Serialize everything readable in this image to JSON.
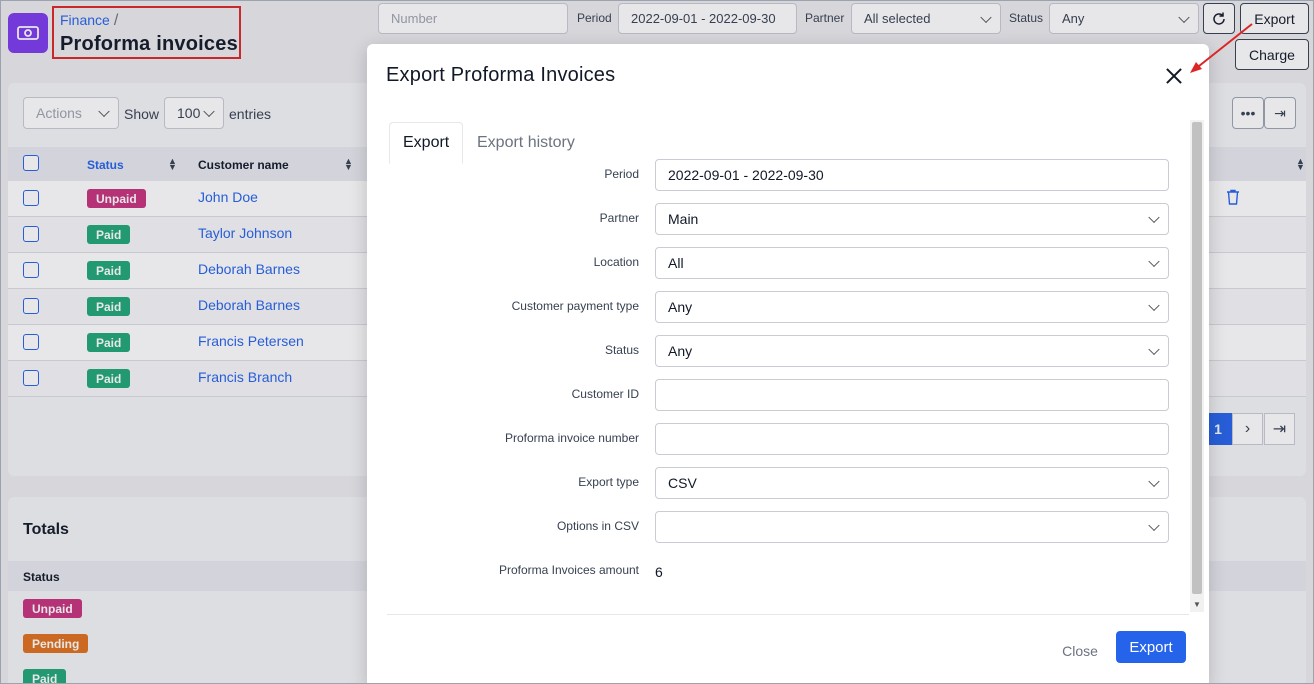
{
  "breadcrumb": {
    "parent": "Finance",
    "separator": "/"
  },
  "page": {
    "title": "Proforma invoices"
  },
  "filters": {
    "number_placeholder": "Number",
    "period_label": "Period",
    "period_value": "2022-09-01 - 2022-09-30",
    "partner_label": "Partner",
    "partner_value": "All selected",
    "status_label": "Status",
    "status_value": "Any"
  },
  "toolbar": {
    "export_label": "Export",
    "charge_label": "Charge",
    "refresh_icon": "refresh-icon"
  },
  "table": {
    "actions_label": "Actions",
    "show_label": "Show",
    "entries_value": "100",
    "entries_label": "entries",
    "columns": {
      "status": "Status",
      "customer": "Customer name"
    },
    "rows": [
      {
        "status": "Unpaid",
        "customer": "John Doe"
      },
      {
        "status": "Paid",
        "customer": "Taylor Johnson"
      },
      {
        "status": "Paid",
        "customer": "Deborah Barnes"
      },
      {
        "status": "Paid",
        "customer": "Deborah Barnes"
      },
      {
        "status": "Paid",
        "customer": "Francis Petersen"
      },
      {
        "status": "Paid",
        "customer": "Francis Branch"
      }
    ],
    "pagination": {
      "current": "1"
    }
  },
  "totals": {
    "title": "Totals",
    "status_header": "Status",
    "statuses": [
      "Unpaid",
      "Pending",
      "Paid"
    ]
  },
  "modal": {
    "title": "Export Proforma Invoices",
    "tabs": [
      "Export",
      "Export history"
    ],
    "fields": {
      "period": {
        "label": "Period",
        "value": "2022-09-01 - 2022-09-30"
      },
      "partner": {
        "label": "Partner",
        "value": "Main"
      },
      "location": {
        "label": "Location",
        "value": "All"
      },
      "payment_type": {
        "label": "Customer payment type",
        "value": "Any"
      },
      "status": {
        "label": "Status",
        "value": "Any"
      },
      "customer_id": {
        "label": "Customer ID",
        "value": ""
      },
      "invoice_number": {
        "label": "Proforma invoice number",
        "value": ""
      },
      "export_type": {
        "label": "Export type",
        "value": "CSV"
      },
      "options_csv": {
        "label": "Options in CSV",
        "value": ""
      },
      "amount": {
        "label": "Proforma Invoices amount",
        "value": "6"
      }
    },
    "close_label": "Close",
    "export_label": "Export"
  },
  "colors": {
    "accent": "#2563eb",
    "unpaid": "#c5317c",
    "paid": "#1fa776",
    "pending": "#e0701d",
    "annotation": "#dc2626"
  }
}
